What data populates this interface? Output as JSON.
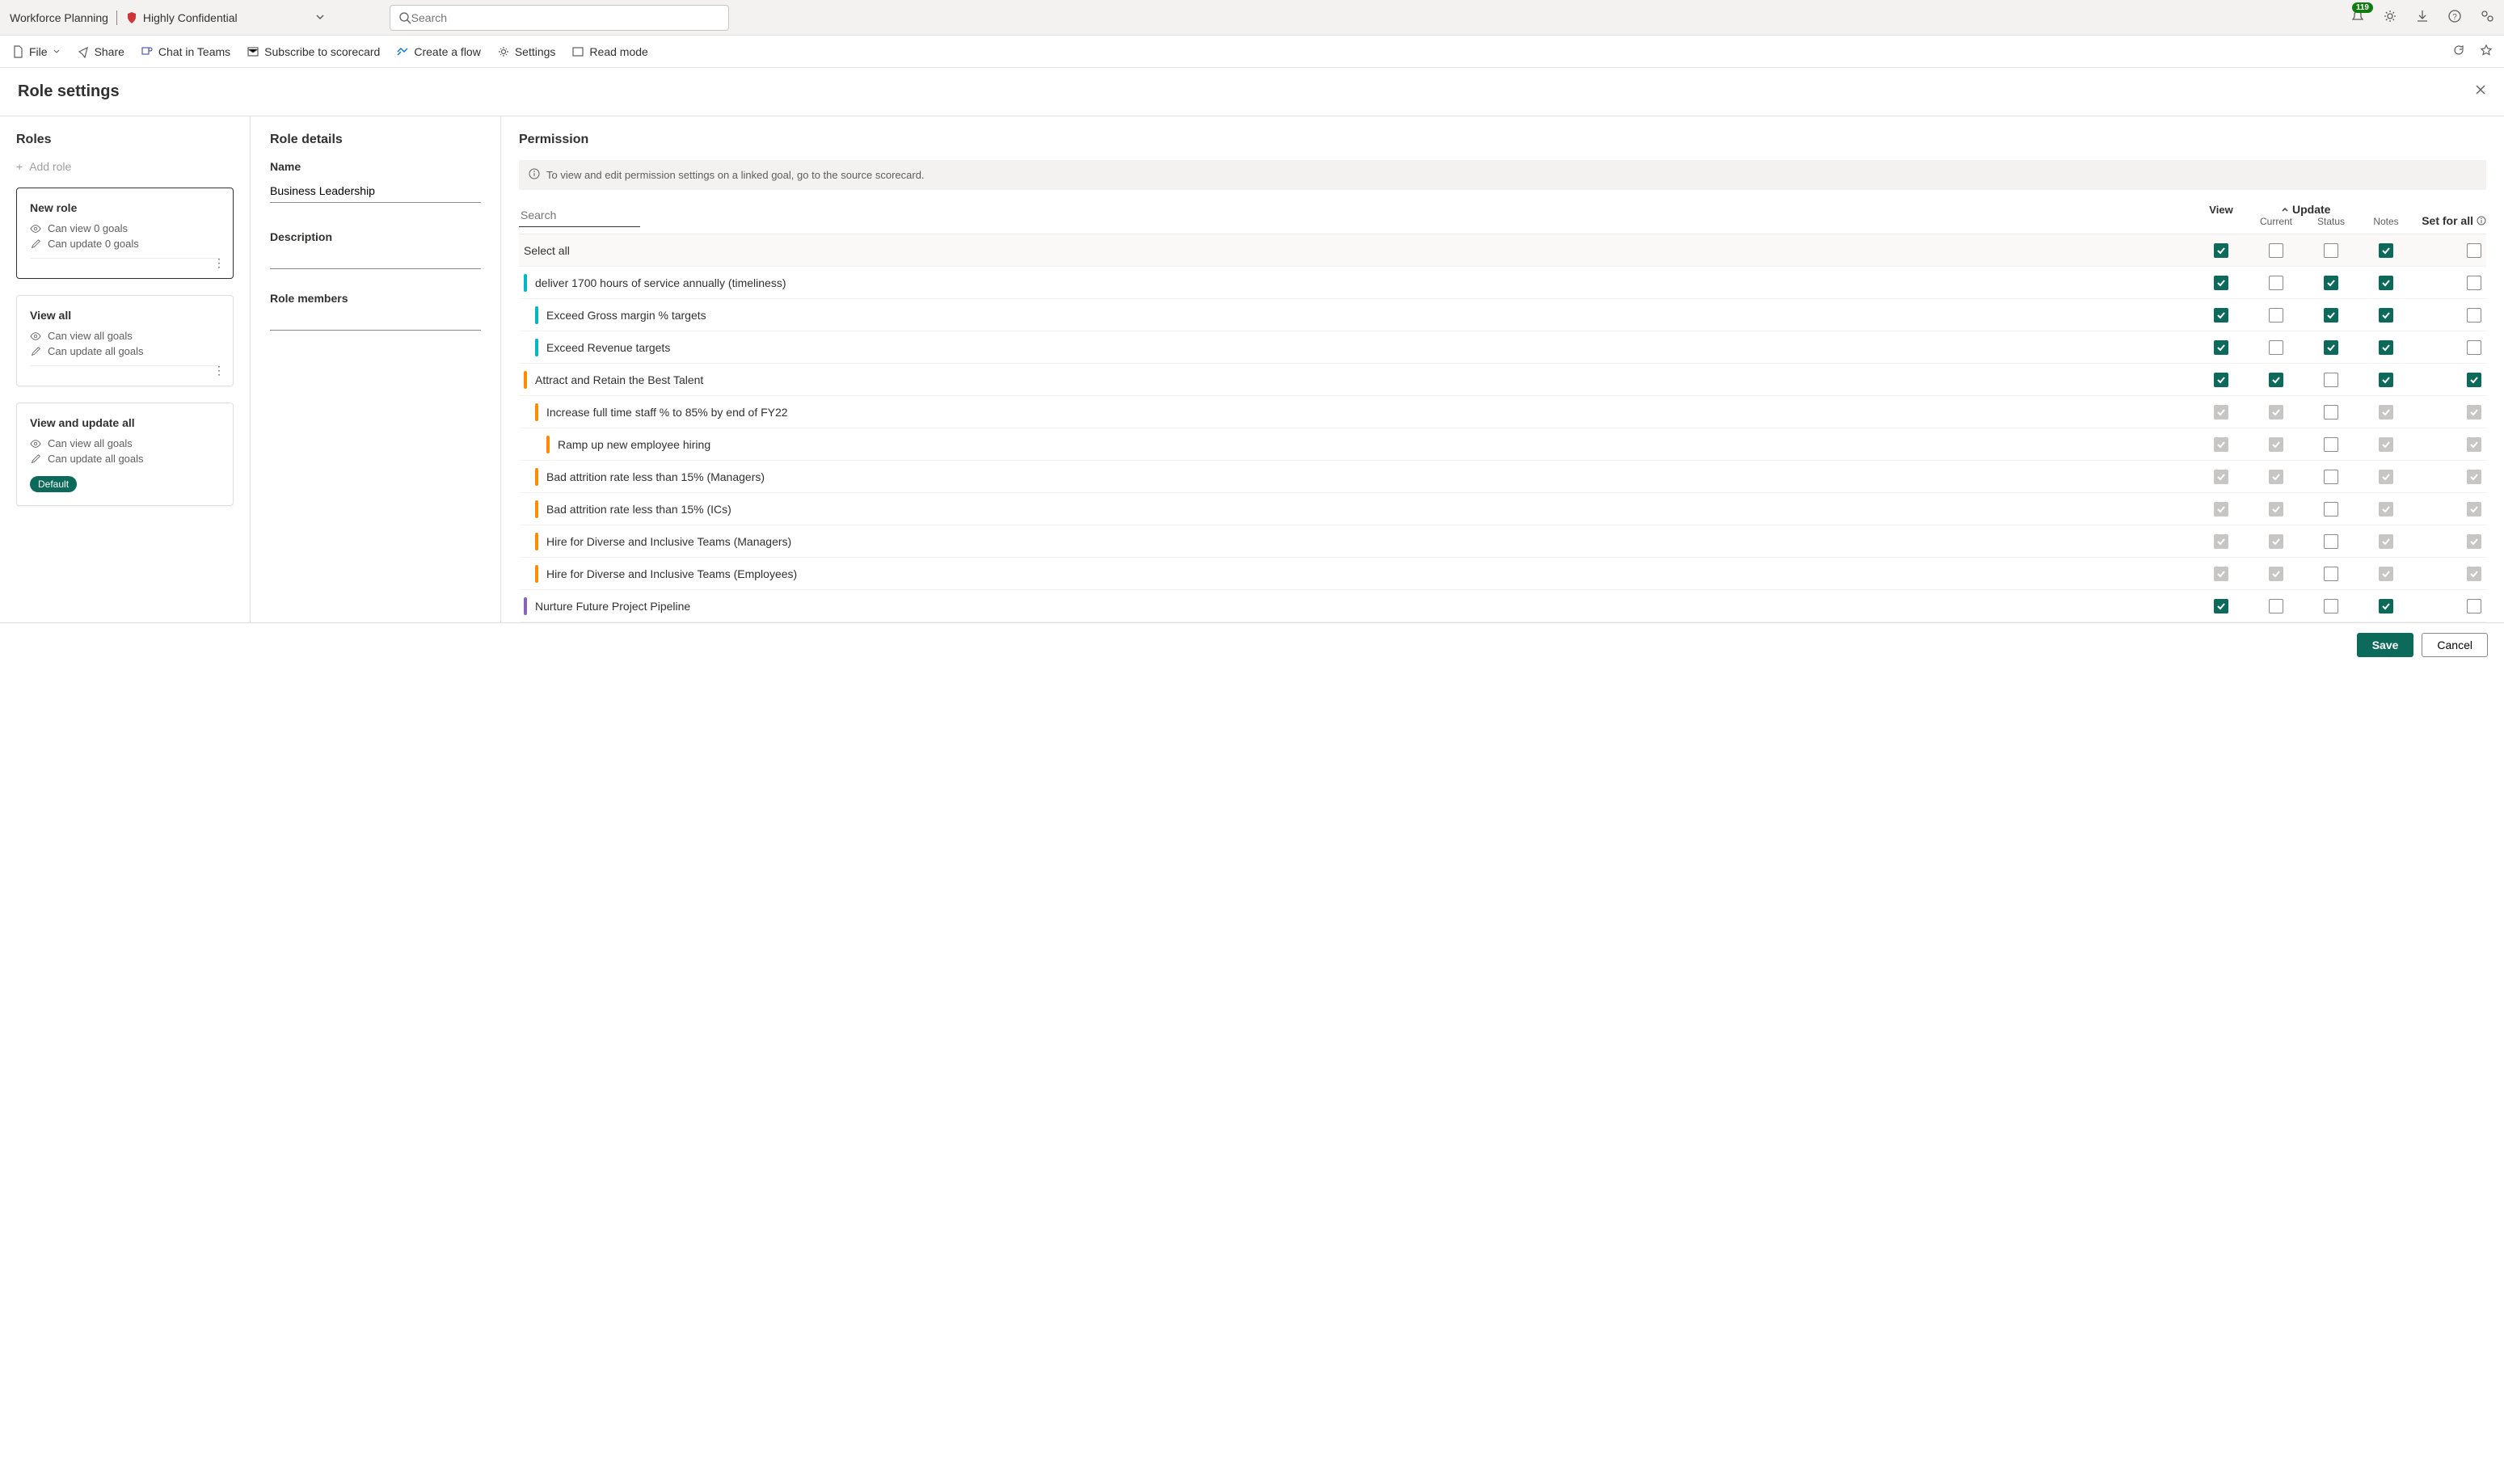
{
  "topbar": {
    "app_title": "Workforce Planning",
    "sensitivity_label": "Highly Confidential",
    "search_placeholder": "Search",
    "notification_count": "119"
  },
  "ribbon": {
    "file": "File",
    "share": "Share",
    "chat": "Chat in Teams",
    "subscribe": "Subscribe to scorecard",
    "flow": "Create a flow",
    "settings": "Settings",
    "readmode": "Read mode"
  },
  "page_title": "Role settings",
  "roles": {
    "heading": "Roles",
    "add_label": "Add role",
    "cards": [
      {
        "title": "New role",
        "view_text": "Can view 0 goals",
        "update_text": "Can update 0 goals",
        "active": true,
        "more": true
      },
      {
        "title": "View all",
        "view_text": "Can view all goals",
        "update_text": "Can update all goals",
        "active": false,
        "more": true
      },
      {
        "title": "View and update all",
        "view_text": "Can view all goals",
        "update_text": "Can update all goals",
        "active": false,
        "default": true
      }
    ]
  },
  "details": {
    "heading": "Role details",
    "name_label": "Name",
    "name_value": "Business Leadership",
    "description_label": "Description",
    "members_label": "Role members"
  },
  "permission": {
    "heading": "Permission",
    "info_text": "To view and edit permission settings on a linked goal, go to the source scorecard.",
    "search_placeholder": "Search",
    "col_view": "View",
    "col_update": "Update",
    "col_current": "Current",
    "col_status": "Status",
    "col_notes": "Notes",
    "col_setforall": "Set for all",
    "select_all": "Select all",
    "rows": [
      {
        "label": "Select all",
        "indent": 0,
        "bar": "",
        "header": true,
        "view": "checked",
        "current": "unchecked",
        "status": "unchecked",
        "notes": "checked",
        "setforall": "unchecked"
      },
      {
        "label": "deliver 1700 hours of service annually (timeliness)",
        "indent": 1,
        "bar": "cyan",
        "view": "checked",
        "current": "unchecked",
        "status": "checked",
        "notes": "checked",
        "setforall": "unchecked"
      },
      {
        "label": "Exceed Gross margin % targets",
        "indent": 2,
        "bar": "cyan",
        "view": "checked",
        "current": "unchecked",
        "status": "checked",
        "notes": "checked",
        "setforall": "unchecked"
      },
      {
        "label": "Exceed Revenue targets",
        "indent": 2,
        "bar": "cyan",
        "view": "checked",
        "current": "unchecked",
        "status": "checked",
        "notes": "checked",
        "setforall": "unchecked"
      },
      {
        "label": "Attract and Retain the Best Talent",
        "indent": 1,
        "bar": "orange",
        "view": "checked",
        "current": "checked",
        "status": "unchecked",
        "notes": "checked",
        "setforall": "checked"
      },
      {
        "label": "Increase full time staff % to 85% by end of FY22",
        "indent": 2,
        "bar": "orange",
        "view": "disabled",
        "current": "disabled",
        "status": "unchecked",
        "notes": "disabled",
        "setforall": "disabled"
      },
      {
        "label": "Ramp up new employee hiring",
        "indent": 3,
        "bar": "orange",
        "view": "disabled",
        "current": "disabled",
        "status": "unchecked",
        "notes": "disabled",
        "setforall": "disabled"
      },
      {
        "label": "Bad attrition rate less than 15% (Managers)",
        "indent": 2,
        "bar": "orange",
        "view": "disabled",
        "current": "disabled",
        "status": "unchecked",
        "notes": "disabled",
        "setforall": "disabled"
      },
      {
        "label": "Bad attrition rate less than 15% (ICs)",
        "indent": 2,
        "bar": "orange",
        "view": "disabled",
        "current": "disabled",
        "status": "unchecked",
        "notes": "disabled",
        "setforall": "disabled"
      },
      {
        "label": "Hire for Diverse and Inclusive Teams (Managers)",
        "indent": 2,
        "bar": "orange",
        "view": "disabled",
        "current": "disabled",
        "status": "unchecked",
        "notes": "disabled",
        "setforall": "disabled"
      },
      {
        "label": "Hire for Diverse and Inclusive Teams (Employees)",
        "indent": 2,
        "bar": "orange",
        "view": "disabled",
        "current": "disabled",
        "status": "unchecked",
        "notes": "disabled",
        "setforall": "disabled"
      },
      {
        "label": "Nurture Future Project Pipeline",
        "indent": 1,
        "bar": "purple",
        "view": "checked",
        "current": "unchecked",
        "status": "unchecked",
        "notes": "checked",
        "setforall": "unchecked"
      }
    ]
  },
  "footer": {
    "save": "Save",
    "cancel": "Cancel",
    "default_label": "Default"
  }
}
